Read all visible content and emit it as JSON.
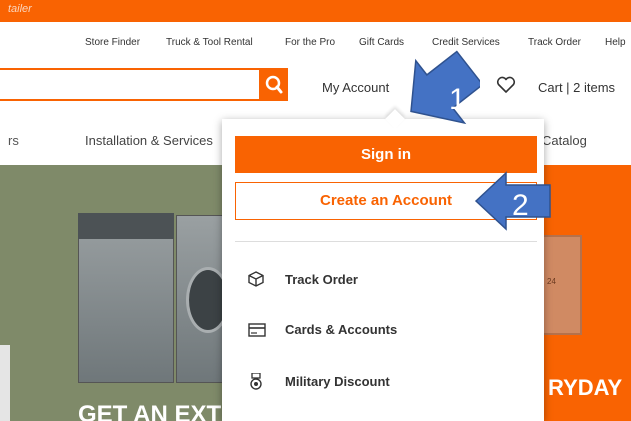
{
  "top_banner": {
    "text": "tailer"
  },
  "utility_nav": [
    {
      "label": "Store Finder"
    },
    {
      "label": "Truck & Tool Rental"
    },
    {
      "label": "For the Pro"
    },
    {
      "label": "Gift Cards"
    },
    {
      "label": "Credit Services"
    },
    {
      "label": "Track Order"
    },
    {
      "label": "Help"
    }
  ],
  "header": {
    "my_account_label": "My Account",
    "cart_label": "Cart | 2 items"
  },
  "category_nav": {
    "fragment": "rs",
    "installation": "Installation & Services",
    "catalog": "Catalog"
  },
  "dropdown": {
    "sign_in": "Sign in",
    "create_account": "Create an Account",
    "items": [
      {
        "label": "Track Order",
        "icon": "package-icon"
      },
      {
        "label": "Cards & Accounts",
        "icon": "credit-card-icon"
      },
      {
        "label": "Military Discount",
        "icon": "medal-icon"
      }
    ]
  },
  "hero": {
    "left_text": "GET AN EXT",
    "right_text": "RYDAY",
    "plate_text": "24"
  },
  "annotations": [
    {
      "label": "1"
    },
    {
      "label": "2"
    }
  ],
  "colors": {
    "brand_orange": "#f96302",
    "arrow_blue": "#4472c4",
    "hero_green": "#7f8a69"
  }
}
